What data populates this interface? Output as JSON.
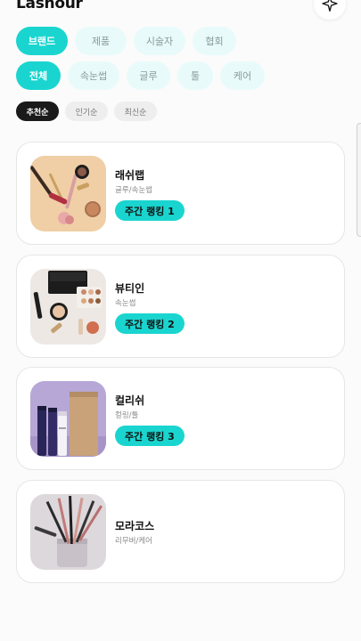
{
  "app": {
    "title": "Lashour"
  },
  "category_tabs": [
    {
      "label": "브랜드",
      "active": true
    },
    {
      "label": "제품",
      "active": false
    },
    {
      "label": "시술자",
      "active": false
    },
    {
      "label": "협회",
      "active": false
    }
  ],
  "filter_tabs": [
    {
      "label": "전체",
      "active": true
    },
    {
      "label": "속눈썹",
      "active": false
    },
    {
      "label": "글루",
      "active": false
    },
    {
      "label": "툴",
      "active": false
    },
    {
      "label": "케어",
      "active": false
    }
  ],
  "sort_options": [
    {
      "label": "추천순",
      "active": true
    },
    {
      "label": "인기순",
      "active": false
    },
    {
      "label": "최신순",
      "active": false
    }
  ],
  "brands": [
    {
      "name": "래쉬랩",
      "category": "글루/속눈썹",
      "rank_label": "주간 랭킹 1"
    },
    {
      "name": "뷰티인",
      "category": "속눈썹",
      "rank_label": "주간 랭킹 2"
    },
    {
      "name": "컬리쉬",
      "category": "컬링/툴",
      "rank_label": "주간 랭킹 3"
    },
    {
      "name": "모라코스",
      "category": "리무버/케어"
    }
  ],
  "icons": {
    "sparkle": "sparkle-icon"
  },
  "colors": {
    "accent": "#1ad5cf",
    "chip_bg": "#e8fbfa",
    "dark": "#1a1a1a"
  }
}
